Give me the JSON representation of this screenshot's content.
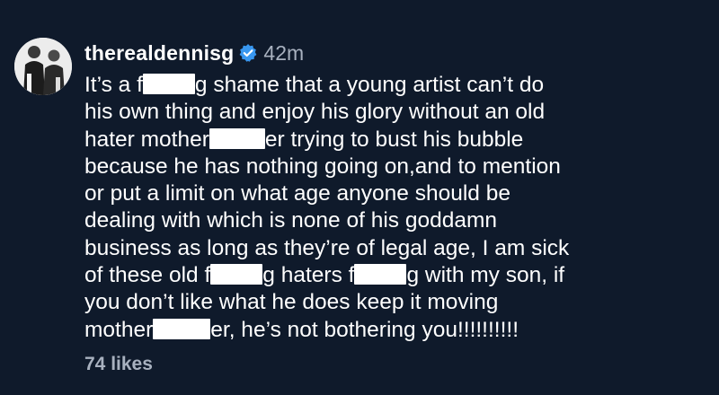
{
  "comment": {
    "username": "therealdennisg",
    "verified_icon": "verified-badge-icon",
    "timestamp": "42m",
    "avatar_icon": "profile-photo",
    "censor_color": "#ffffff",
    "lines": [
      {
        "a": "It’s a f",
        "b": "g shame that a young artist can’t do"
      },
      {
        "a": "his own thing and enjoy his glory without an old"
      },
      {
        "a": "hater mother",
        "b": "er trying to bust his bubble"
      },
      {
        "a": "because he has nothing going on,and to mention"
      },
      {
        "a": "or put a limit on what age anyone should be"
      },
      {
        "a": "dealing with which is none of his goddamn"
      },
      {
        "a": "business as long as they’re of legal age, I am sick"
      },
      {
        "a": "of these old f",
        "b": "g haters f",
        "c": "g with my son, if"
      },
      {
        "a": "you don’t like what he does keep it moving"
      },
      {
        "a": "mother",
        "b": "er, he’s not bothering you!!!!!!!!!!"
      }
    ],
    "likes": "74 likes"
  },
  "colors": {
    "background": "#0f1a2b",
    "text": "#ffffff",
    "muted": "#a8b1bf",
    "verified": "#3897f0"
  }
}
